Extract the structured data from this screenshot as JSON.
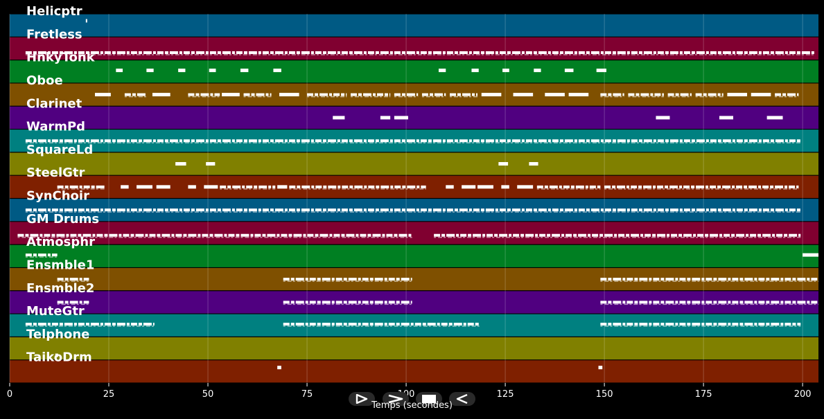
{
  "chart_data": {
    "type": "piano-roll",
    "xlabel": "Temps (secondes)",
    "xlim": [
      0,
      204
    ],
    "x_ticks": [
      0,
      25,
      50,
      75,
      100,
      125,
      150,
      175,
      200
    ],
    "grid": true,
    "tracks": [
      {
        "name": "Helicptr",
        "color": "#005a84",
        "notes": [
          [
            19.2,
            19.5,
            0.3
          ]
        ]
      },
      {
        "name": "Fretless",
        "color": "#800030",
        "notes": [
          [
            4,
            203,
            0.68
          ]
        ]
      },
      {
        "name": "HnkyTonk",
        "color": "#007f22",
        "notes": [
          [
            26.8,
            28.5,
            0.45
          ],
          [
            34.5,
            36.3,
            0.45
          ],
          [
            42.5,
            44.3,
            0.45
          ],
          [
            50.3,
            52,
            0.45
          ],
          [
            58.2,
            60.2,
            0.45
          ],
          [
            66.5,
            68.5,
            0.45
          ],
          [
            108.2,
            110,
            0.45
          ],
          [
            116.5,
            118.3,
            0.45
          ],
          [
            124.3,
            126,
            0.45
          ],
          [
            132.2,
            134,
            0.45
          ],
          [
            140,
            142.2,
            0.45
          ],
          [
            148,
            150.5,
            0.45
          ]
        ]
      },
      {
        "name": "Oboe",
        "color": "#7f5000",
        "notes": [
          [
            21.5,
            25.5,
            0.5
          ],
          [
            29,
            34.5,
            0.5
          ],
          [
            36,
            40.5,
            0.5
          ],
          [
            45,
            53,
            0.5
          ],
          [
            53.5,
            58,
            0.5
          ],
          [
            59,
            66,
            0.5
          ],
          [
            68,
            73,
            0.5
          ],
          [
            75,
            85,
            0.5
          ],
          [
            86,
            96,
            0.5
          ],
          [
            97,
            103,
            0.5
          ],
          [
            104,
            110,
            0.5
          ],
          [
            111,
            118,
            0.5
          ],
          [
            119,
            124,
            0.5
          ],
          [
            127,
            132,
            0.5
          ],
          [
            135,
            140,
            0.5
          ],
          [
            141,
            146,
            0.5
          ],
          [
            149,
            155,
            0.5
          ],
          [
            156,
            165,
            0.5
          ],
          [
            166,
            172,
            0.5
          ],
          [
            173,
            180,
            0.5
          ],
          [
            181,
            186,
            0.5
          ],
          [
            187,
            192,
            0.5
          ],
          [
            193,
            199,
            0.5
          ]
        ]
      },
      {
        "name": "Clarinet",
        "color": "#500080",
        "notes": [
          [
            81.5,
            84.5,
            0.5
          ],
          [
            93.5,
            96,
            0.5
          ],
          [
            97,
            100.5,
            0.5
          ],
          [
            163,
            166.5,
            0.5
          ],
          [
            179,
            182.5,
            0.5
          ],
          [
            191,
            195,
            0.5
          ]
        ]
      },
      {
        "name": "WarmPd",
        "color": "#008080",
        "notes": [
          [
            4,
            199.5,
            0.5
          ]
        ]
      },
      {
        "name": "SquareLd",
        "color": "#808000",
        "notes": [
          [
            41.8,
            44.5,
            0.5
          ],
          [
            49.5,
            51.8,
            0.5
          ],
          [
            123.3,
            125.7,
            0.5
          ],
          [
            131,
            133.3,
            0.5
          ]
        ]
      },
      {
        "name": "SteelGtr",
        "color": "#7f2000",
        "notes": [
          [
            12,
            24,
            0.5
          ],
          [
            28,
            30,
            0.5
          ],
          [
            32,
            36,
            0.5
          ],
          [
            37,
            40.5,
            0.5
          ],
          [
            45,
            47,
            0.5
          ],
          [
            49,
            52.5,
            0.5
          ],
          [
            53,
            67,
            0.5
          ],
          [
            67.5,
            70,
            0.5
          ],
          [
            70.5,
            105,
            0.5
          ],
          [
            110,
            112,
            0.5
          ],
          [
            114,
            117.5,
            0.5
          ],
          [
            118,
            122,
            0.5
          ],
          [
            124,
            126,
            0.5
          ],
          [
            128,
            132,
            0.5
          ],
          [
            133,
            149,
            0.5
          ],
          [
            150,
            199,
            0.5
          ]
        ]
      },
      {
        "name": "SynChoir",
        "color": "#005a84",
        "notes": [
          [
            4,
            199.5,
            0.5
          ]
        ]
      },
      {
        "name": "GM Drums",
        "color": "#800030",
        "notes": [
          [
            2,
            101.5,
            0.6
          ],
          [
            107,
            199.5,
            0.6
          ]
        ]
      },
      {
        "name": "Atmosphr",
        "color": "#007f22",
        "notes": [
          [
            4,
            12,
            0.45
          ],
          [
            200,
            204,
            0.45
          ]
        ]
      },
      {
        "name": "Ensmble1",
        "color": "#7f5000",
        "notes": [
          [
            12,
            20,
            0.5
          ],
          [
            69,
            101.5,
            0.5
          ],
          [
            149,
            204,
            0.5
          ]
        ]
      },
      {
        "name": "Ensmble2",
        "color": "#500080",
        "notes": [
          [
            12,
            20,
            0.5
          ],
          [
            69,
            101.5,
            0.5
          ],
          [
            149,
            204,
            0.5
          ]
        ]
      },
      {
        "name": "MuteGtr",
        "color": "#008080",
        "notes": [
          [
            4,
            36.5,
            0.45
          ],
          [
            69,
            118.5,
            0.45
          ],
          [
            149,
            199.5,
            0.45
          ]
        ]
      },
      {
        "name": "Telphone",
        "color": "#808000",
        "notes": [
          [
            11.5,
            12.2,
            0.8
          ]
        ]
      },
      {
        "name": "TaikoDrm",
        "color": "#7f2000",
        "notes": [
          [
            67.5,
            68.5,
            0.33
          ],
          [
            148.5,
            149.5,
            0.33
          ]
        ]
      }
    ]
  },
  "controls": [
    {
      "name": "step-forward-button",
      "icon": "step-forward-icon"
    },
    {
      "name": "fast-forward-button",
      "icon": "fast-forward-icon"
    },
    {
      "name": "stop-button",
      "icon": "stop-icon"
    },
    {
      "name": "rewind-button",
      "icon": "rewind-icon"
    }
  ]
}
